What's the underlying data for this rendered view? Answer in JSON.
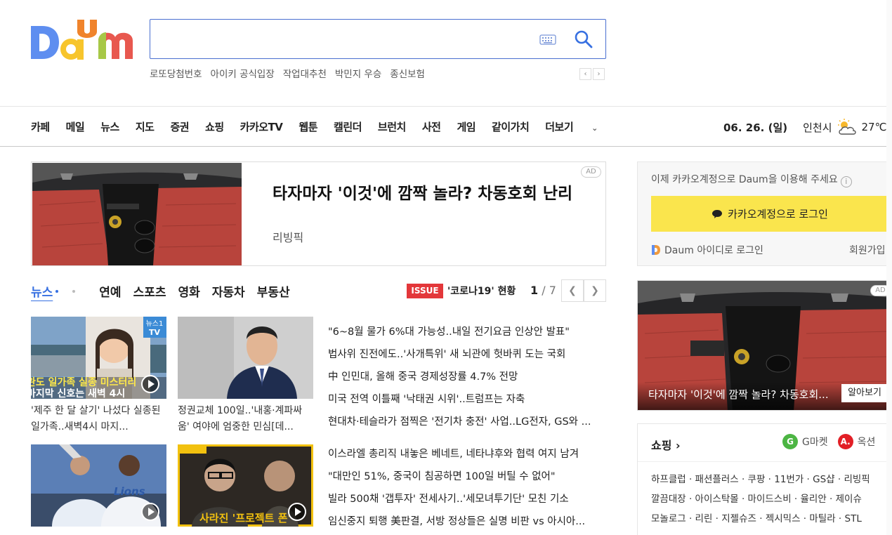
{
  "header": {
    "search_placeholder": "",
    "suggestions": [
      "로또당첨번호",
      "아이키 공식입장",
      "작업대추천",
      "박민지 우승",
      "종신보험"
    ]
  },
  "gnb": {
    "items": [
      "카페",
      "메일",
      "뉴스",
      "지도",
      "증권",
      "쇼핑",
      "카카오TV",
      "웹툰",
      "캘린더",
      "브런치",
      "사전",
      "게임",
      "같이가치",
      "더보기"
    ],
    "date": "06. 26. (일)",
    "city": "인천시",
    "temp": "27℃"
  },
  "ad_banner": {
    "title": "타자마자 '이것'에 깜짝 놀라? 차동호회 난리",
    "source": "리빙픽",
    "badge": "AD"
  },
  "news": {
    "tabs": [
      "뉴스",
      "연예",
      "스포츠",
      "영화",
      "자동차",
      "부동산"
    ],
    "issue_badge": "ISSUE",
    "issue_text": "'코로나19' 현황",
    "page_current": "1",
    "page_total": "7",
    "thumbs": [
      {
        "caption": "'제주 한 달 살기' 나섰다 실종된 일가족..새벽4시 마지...",
        "overlay_line1": "완도 일가족 실종 미스터리",
        "overlay_line2": "마지막 신호는 새벽 4시",
        "tag": "뉴스1 TV"
      },
      {
        "caption": "정권교체 100일..'내홍·계파싸움' 여야에 엄중한 민심[데...",
        "overlay_line1": "",
        "overlay_line2": "",
        "tag": ""
      },
      {
        "caption": "",
        "overlay_line1": "",
        "overlay_line2": "",
        "tag": "Lions"
      },
      {
        "caption": "",
        "overlay_line1": "사라진 '프로젝트 폰'",
        "overlay_line2": "",
        "tag": ""
      }
    ],
    "headlines_1": [
      "\"6~8월 물가 6%대 가능성..내일 전기요금 인상안 발표\"",
      "법사위 진전에도..'사개특위' 새 뇌관에 헛바퀴 도는 국회",
      "中 인민대, 올해 중국 경제성장률 4.7% 전망",
      "미국 전역 이틀째 '낙태권 시위'..트럼프는 자축",
      "현대차·테슬라가 점찍은 '전기차 충전' 사업..LG전자, GS와 ..."
    ],
    "headlines_2": [
      "이스라엘 총리직 내놓은 베네트, 네타냐후와 협력 여지 남겨",
      "\"대만인 51%, 중국이 침공하면 100일 버틸 수 없어\"",
      "빌라 500채 '갭투자' 전세사기..'세모녀투기단' 모친 기소",
      "임신중지 퇴행 美판결, 서방 정상들은 실명 비판 vs 아시아..."
    ]
  },
  "login": {
    "message": "이제 카카오계정으로 Daum을 이용해 주세요",
    "kakao_button": "카카오계정으로 로그인",
    "daum_id": "Daum 아이디로 로그인",
    "signup": "회원가입"
  },
  "side_ad": {
    "title": "타자마자 '이것'에 깜짝 놀라? 차동호회...",
    "more": "알아보기",
    "badge": "AD"
  },
  "shopping": {
    "title": "쇼핑",
    "brand1": "G마켓",
    "brand1_icon": "G",
    "brand2": "옥션",
    "brand2_icon": "A.",
    "links_row1": "하프클럽 · 패션플러스 · 쿠팡 · 11번가 · GS샵 · 리빙픽",
    "links_row2": "깔끔대장 · 아이스탁몰 · 마이드스비 · 율리안 · 제이슈",
    "links_row3": "모놀로그 · 리린 · 지젤슈즈 · 젝시믹스 · 마틸라 · STL"
  },
  "colors": {
    "accent": "#3770e1",
    "kakao_yellow": "#fae54d",
    "issue_red": "#e3373a",
    "gmarket_green": "#4cb543",
    "auction_red": "#e21f26"
  }
}
